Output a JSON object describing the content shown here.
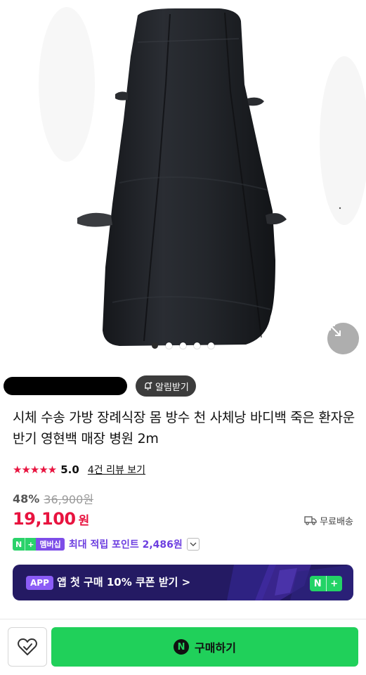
{
  "gallery": {
    "image_alt": "black body bag product photo",
    "slide_count": 5,
    "active_slide": 1,
    "expand_icon": "expand-arrows-icon"
  },
  "seller": {
    "name_redacted": true,
    "notify_label": "알림받기",
    "notify_icon": "bell-plus-icon"
  },
  "product": {
    "title": "시체 수송 가방 장례식장 몸 방수 천 사체낭 바디백 죽은 환자운반기 영현백 매장 병원 2m",
    "rating_stars": 5,
    "rating_value": "5.0",
    "review_link": "4건 리뷰 보기"
  },
  "price": {
    "discount_rate": "48%",
    "original_price": "36,900원",
    "sale_price": "19,100",
    "currency": "원",
    "shipping": "무료배송",
    "shipping_icon": "truck-icon"
  },
  "membership": {
    "badge_n": "N",
    "badge_plus": "+",
    "badge_label": "멤버십",
    "point_text": "최대 적립 포인트 2,486원",
    "chevron_icon": "chevron-down-icon"
  },
  "app_banner": {
    "tag": "APP",
    "text": "앱 첫 구매 10% 쿠폰 받기 >",
    "badge_n": "N",
    "badge_plus": "+"
  },
  "bottom_bar": {
    "wish_icon": "heart-check-icon",
    "buy_icon_letter": "N",
    "buy_label": "구매하기"
  },
  "colors": {
    "accent_red": "#e8133f",
    "naver_green": "#20d05a",
    "membership_purple": "#6d3fe0",
    "banner_bg": "#241a63"
  }
}
